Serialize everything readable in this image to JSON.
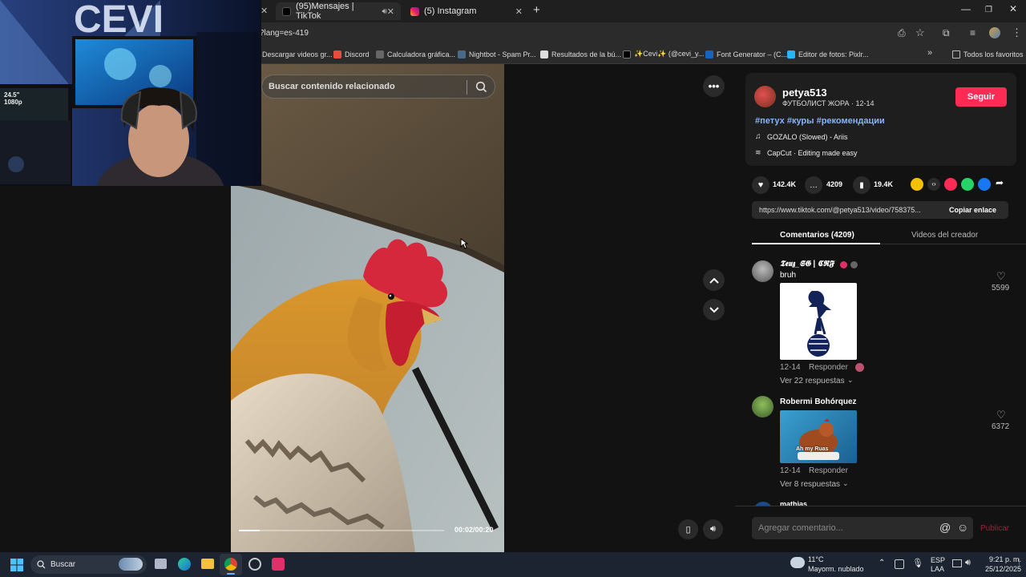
{
  "tabs": [
    {
      "label": "(95)Mensajes | TikTok",
      "active": true
    },
    {
      "label": "(5) Instagram",
      "active": false
    }
  ],
  "new_tab_symbol": "+",
  "address": {
    "url": "?lang=es-419"
  },
  "bookmarks": [
    "Descargar videos gr...",
    "Discord",
    "Calculadora gráfica...",
    "Nightbot - Spam Pr...",
    "Resultados de la bú...",
    "✨Cevi✨ (@cevi_y...",
    "Font Generator – (C...",
    "Editor de fotos: Pixlr...",
    "Todos los favoritos"
  ],
  "search": {
    "placeholder": "Buscar contenido relacionado"
  },
  "video": {
    "time": "00:02/00:20",
    "progress": 0.1
  },
  "creator": {
    "username": "petya513",
    "subtitle": "ФУТБОЛИСТ ЖОРА · 12-14",
    "follow_label": "Seguir",
    "hashtags": "#петух #куры #рекомендации",
    "music": "GOZALO (Slowed) - Ariis",
    "capcut": "CapCut · Editing made easy"
  },
  "stats": {
    "likes": "142.4K",
    "comments": "4209",
    "saves": "19.4K"
  },
  "link": {
    "url": "https://www.tiktok.com/@petya513/video/758375...",
    "copy_label": "Copiar enlace"
  },
  "panel_tabs": {
    "comments": "Comentarios (4209)",
    "creator_videos": "Videos del creador"
  },
  "comments": [
    {
      "user": "𝕿𝖊𝖚𝖟_𝕾𝕲 | 𝕮𝕽𝕱",
      "text": "bruh",
      "date": "12-14",
      "reply": "Responder",
      "likes": "5599",
      "replies": "Ver 22 respuestas"
    },
    {
      "user": "Robermi Bohórquez",
      "text": "",
      "date": "12-14",
      "reply": "Responder",
      "likes": "6372",
      "replies": "Ver 8 respuestas",
      "sticker_text": "Ah my Ruas"
    },
    {
      "user": "mathias"
    }
  ],
  "comment_input": {
    "placeholder": "Agregar comentario...",
    "publish": "Publicar"
  },
  "taskbar": {
    "search": "Buscar",
    "weather_temp": "11°C",
    "weather_desc": "Mayorm. nublado",
    "lang1": "ESP",
    "lang2": "LAA",
    "time": "9:21 p. m.",
    "date": "25/12/2025"
  },
  "webcam_overlay": {
    "monitor_text": "24.5\" 1080p"
  },
  "colors": {
    "follow_red": "#fe2c55",
    "hashtag_blue": "#8ab4f8",
    "taskbar_bg": "#1c2431"
  }
}
